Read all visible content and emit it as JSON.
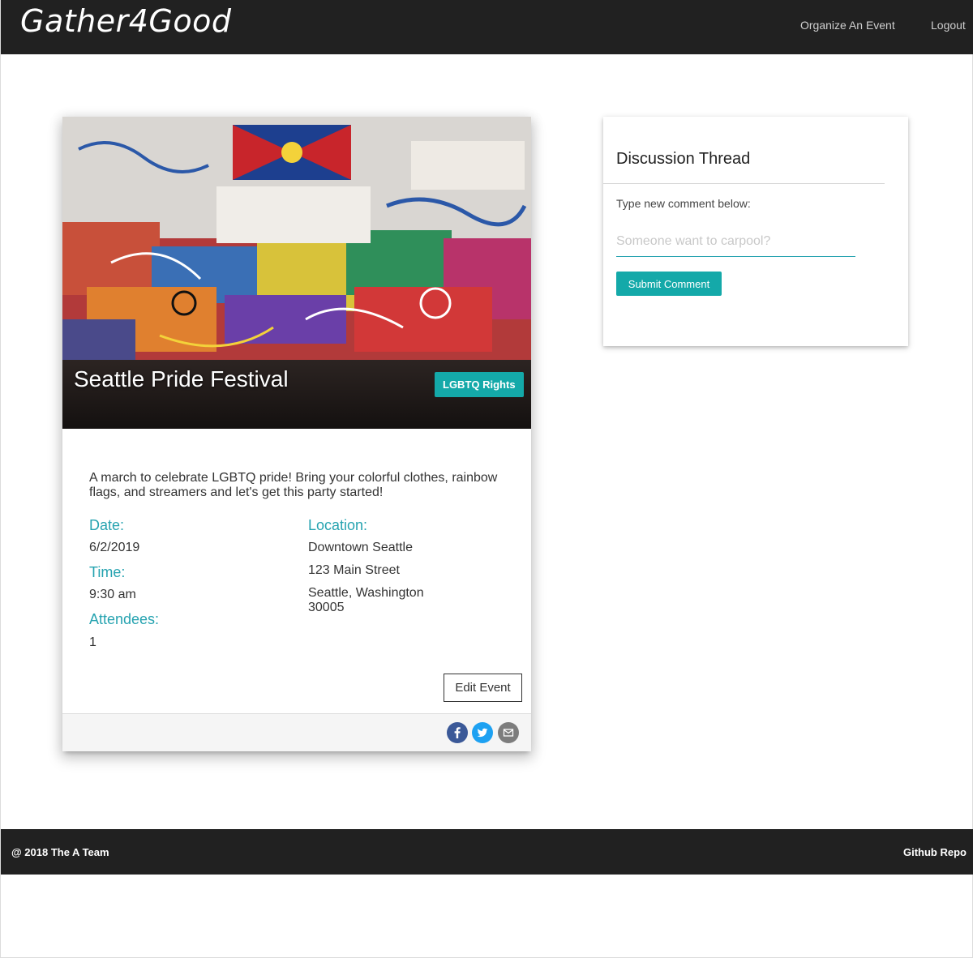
{
  "navbar": {
    "brand": "Gather4Good",
    "links": [
      "Organize An Event",
      "Logout"
    ]
  },
  "event": {
    "title": "Seattle Pride Festival",
    "category": "LGBTQ Rights",
    "description": "A march to celebrate LGBTQ pride! Bring your colorful clothes, rainbow flags, and streamers and let's get this party started!",
    "date_label": "Date:",
    "date": "6/2/2019",
    "time_label": "Time:",
    "time": "9:30 am",
    "attendees_label": "Attendees:",
    "attendees": "1",
    "location_label": "Location:",
    "location_name": "Downtown Seattle",
    "street": "123 Main Street",
    "city_state": "Seattle, Washington",
    "zip": "30005",
    "edit_label": "Edit Event",
    "share_icons": [
      "facebook-icon",
      "twitter-icon",
      "email-icon"
    ]
  },
  "discussion": {
    "title": "Discussion Thread",
    "prompt": "Type new comment below:",
    "placeholder": "Someone want to carpool?",
    "submit_label": "Submit Comment"
  },
  "footer": {
    "copyright": "@ 2018 The A Team",
    "link": "Github Repo"
  },
  "colors": {
    "nav_bg": "#212121",
    "accent": "#14a9a9",
    "label": "#26a3b0"
  }
}
